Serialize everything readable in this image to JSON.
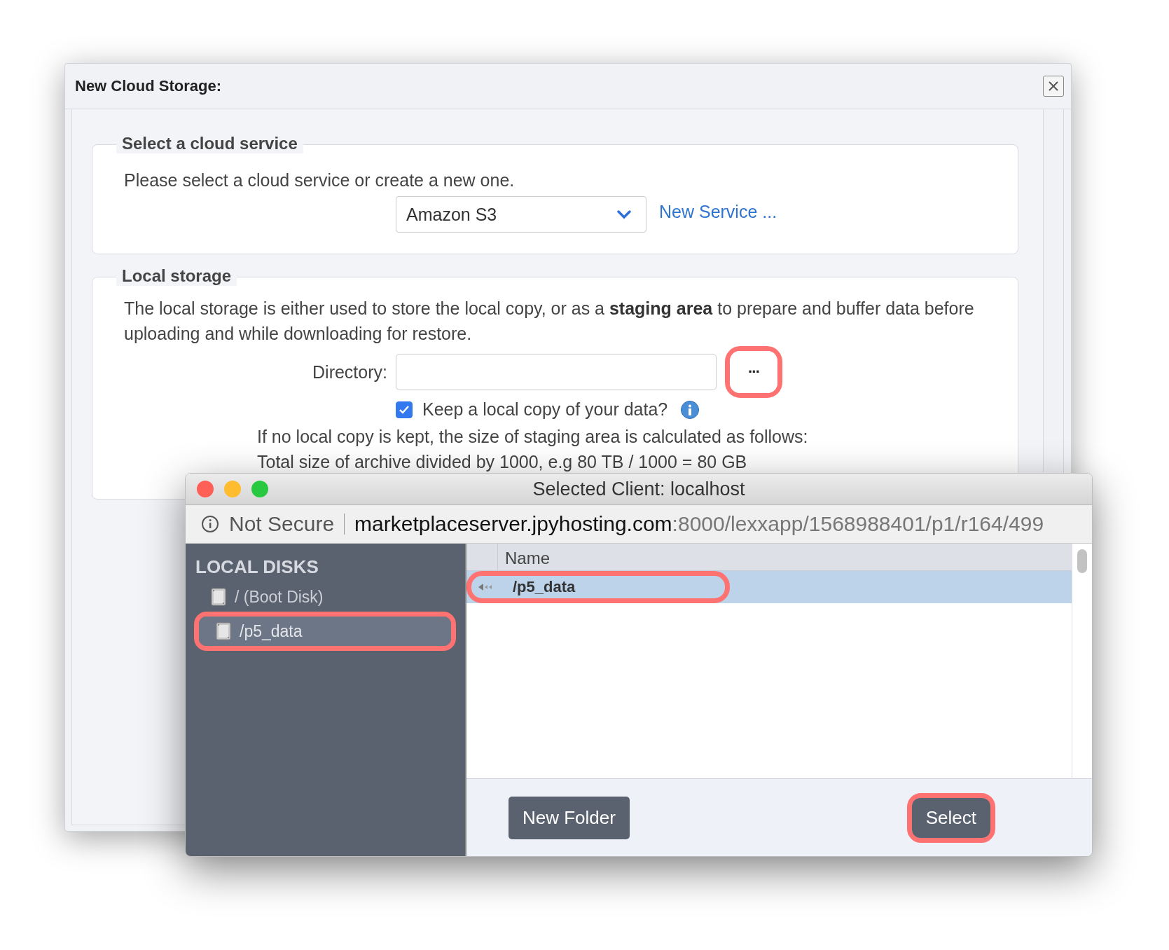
{
  "dialog": {
    "title": "New Cloud Storage:",
    "cloud_section": {
      "legend": "Select a cloud service",
      "intro": "Please select a cloud service or create a new one.",
      "service_value": "Amazon S3",
      "new_service_link": "New Service ..."
    },
    "local_section": {
      "legend": "Local storage",
      "description": "The local storage is either used to store the local copy, or as a **staging area** to prepare and buffer data before uploading and while downloading for restore.",
      "directory_label": "Directory:",
      "browse_button": "···",
      "browse_highlighted": true,
      "keep_copy_label": "Keep a local copy of your data?",
      "keep_copy_checked": true,
      "note_lines": [
        "If no local copy is kept, the size of staging area is calculated as follows:",
        "Total size of archive divided by 1000, e.g 80 TB / 1000 = 80 GB"
      ]
    }
  },
  "browser": {
    "title": "Selected Client: localhost",
    "security": "Not Secure",
    "url_host": "marketplaceserver.jpyhosting.com",
    "url_path": ":8000/lexxapp/1568988401/p1/r164/499",
    "sidebar": {
      "heading": "LOCAL DISKS",
      "items": [
        {
          "label": "/ (Boot Disk)",
          "selected": false,
          "highlighted": false
        },
        {
          "label": "/p5_data",
          "selected": true,
          "highlighted": true
        }
      ]
    },
    "table": {
      "columns": [
        "Name"
      ],
      "rows": [
        {
          "name": "/p5_data",
          "selected": true,
          "highlighted": true
        }
      ]
    },
    "buttons": [
      {
        "label": "New Folder",
        "highlighted": false
      },
      {
        "label": "Select",
        "highlighted": true
      }
    ]
  }
}
